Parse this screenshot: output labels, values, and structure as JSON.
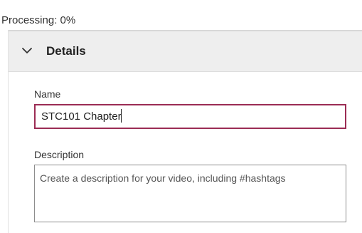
{
  "status": {
    "processing_text": "Processing: 0%",
    "progress": 0
  },
  "details": {
    "title": "Details",
    "expanded": true,
    "toggle_icon": "chevron-down-icon"
  },
  "fields": {
    "name_label": "Name",
    "name_value": "STC101 Chapter",
    "description_label": "Description",
    "description_placeholder": "Create a description for your video, including #hashtags",
    "name_border_color": "#9b2c54"
  }
}
